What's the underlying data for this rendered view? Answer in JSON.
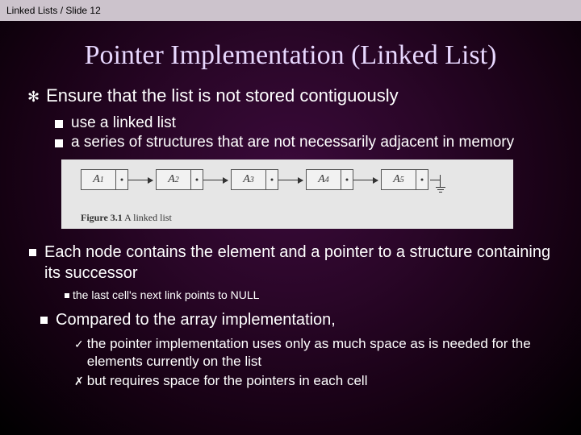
{
  "header": "Linked Lists / Slide 12",
  "title": "Pointer Implementation (Linked List)",
  "bullet_main": "Ensure that the list is not stored contiguously",
  "sub1": "use a linked list",
  "sub2": "a series of structures that are not necessarily adjacent in memory",
  "figure": {
    "nodes": [
      "A",
      "A",
      "A",
      "A",
      "A"
    ],
    "subs": [
      "1",
      "2",
      "3",
      "4",
      "5"
    ],
    "caption_bold": "Figure 3.1",
    "caption_rest": " A linked list"
  },
  "para2": "Each node contains the element and a pointer to a structure containing its successor",
  "para2_sub": "the last cell's next link points to NULL",
  "para3": "Compared to the array implementation,",
  "para3_sub1": "the pointer implementation uses only as much space as is needed for the elements currently on the list",
  "para3_sub2": "but requires space for the pointers in each cell"
}
